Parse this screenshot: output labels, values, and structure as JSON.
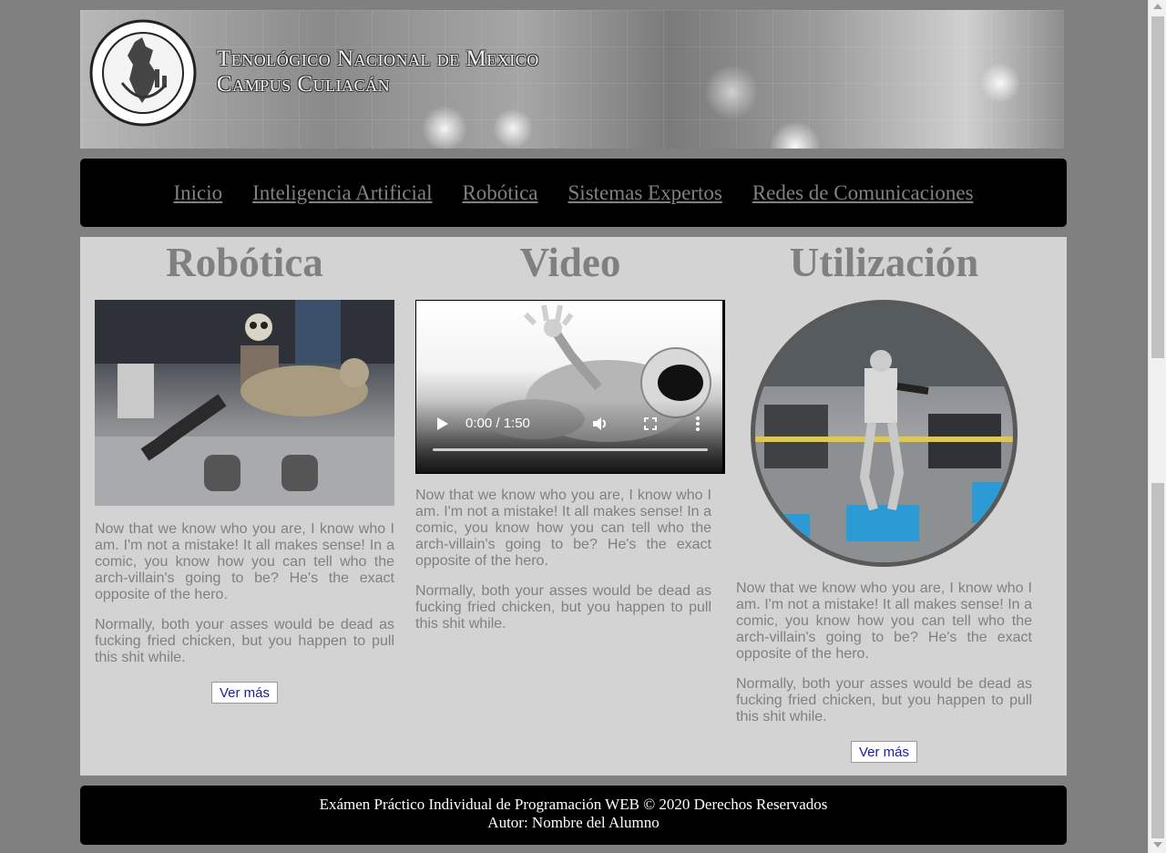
{
  "header": {
    "title_line1": "Tenológico Nacional de Mexico",
    "title_line2": "Campus Culiacán"
  },
  "nav": {
    "items": [
      {
        "label": "Inicio"
      },
      {
        "label": "Inteligencia Artificial"
      },
      {
        "label": "Robótica"
      },
      {
        "label": "Sistemas Expertos"
      },
      {
        "label": "Redes de Comunicaciones"
      }
    ]
  },
  "columns": [
    {
      "title": "Robótica",
      "paragraph1": "Now that we know who you are, I know who I am. I'm not a mistake! It all makes sense! In a comic, you know how you can tell who the arch-villain's going to be? He's the exact opposite of the hero.",
      "paragraph2": "Normally, both your asses would be dead as fucking fried chicken, but you happen to pull this shit while.",
      "button": "Ver más"
    },
    {
      "title": "Video",
      "video_time": "0:00 / 1:50",
      "paragraph1": "Now that we know who you are, I know who I am. I'm not a mistake! It all makes sense! In a comic, you know how you can tell who the arch-villain's going to be? He's the exact opposite of the hero.",
      "paragraph2": "Normally, both your asses would be dead as fucking fried chicken, but you happen to pull this shit while."
    },
    {
      "title": "Utilización",
      "paragraph1": "Now that we know who you are, I know who I am. I'm not a mistake! It all makes sense! In a comic, you know how you can tell who the arch-villain's going to be? He's the exact opposite of the hero.",
      "paragraph2": "Normally, both your asses would be dead as fucking fried chicken, but you happen to pull this shit while.",
      "button": "Ver más"
    }
  ],
  "footer": {
    "line1": "Exámen Práctico Individual de Programación WEB © 2020 Derechos Reservados",
    "line2": "Autor: Nombre del Alumno"
  }
}
